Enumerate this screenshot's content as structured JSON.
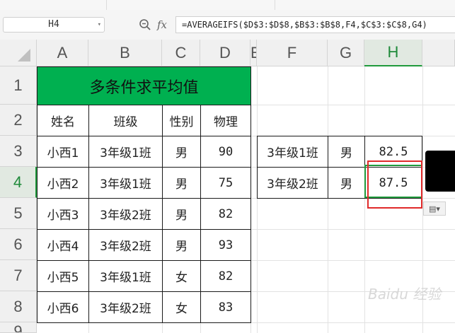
{
  "formula_bar": {
    "name_box": "H4",
    "zoom_icon": "magnifier-icon",
    "fx_label": "fx",
    "formula": "=AVERAGEIFS($D$3:$D$8,$B$3:$B$8,F4,$C$3:$C$8,G4)"
  },
  "columns": [
    "A",
    "B",
    "C",
    "D",
    "E",
    "F",
    "G",
    "H"
  ],
  "rows": [
    "1",
    "2",
    "3",
    "4",
    "5",
    "6",
    "7",
    "8",
    "9"
  ],
  "title": "多条件求平均值",
  "headers": {
    "name": "姓名",
    "class": "班级",
    "gender": "性别",
    "physics": "物理"
  },
  "table": [
    {
      "name": "小西1",
      "class": "3年级1班",
      "gender": "男",
      "physics": "90"
    },
    {
      "name": "小西2",
      "class": "3年级1班",
      "gender": "男",
      "physics": "75"
    },
    {
      "name": "小西3",
      "class": "3年级2班",
      "gender": "男",
      "physics": "82"
    },
    {
      "name": "小西4",
      "class": "3年级2班",
      "gender": "男",
      "physics": "93"
    },
    {
      "name": "小西5",
      "class": "3年级1班",
      "gender": "女",
      "physics": "82"
    },
    {
      "name": "小西6",
      "class": "3年级2班",
      "gender": "女",
      "physics": "83"
    }
  ],
  "criteria": [
    {
      "class": "3年级1班",
      "gender": "男",
      "result": "82.5"
    },
    {
      "class": "3年级2班",
      "gender": "男",
      "result": "87.5"
    }
  ],
  "watermark": "Baidu 经验",
  "colors": {
    "title_bg": "#00b050",
    "highlight": "#e02a2a",
    "selection": "#1f9a3c"
  }
}
